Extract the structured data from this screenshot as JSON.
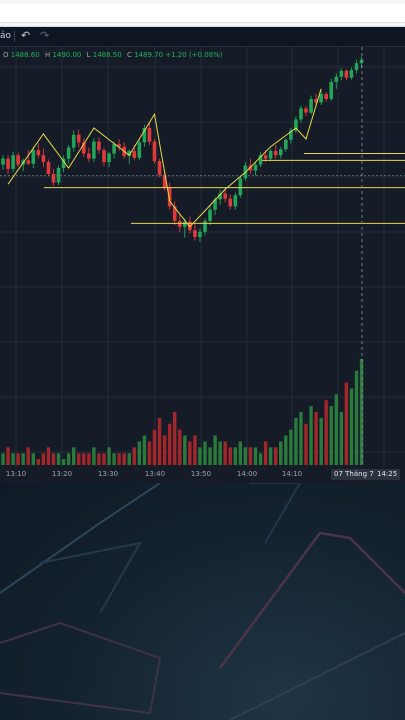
{
  "toolbar": {
    "label": "ảo",
    "undo_icon": "undo-icon",
    "redo_icon": "redo-icon"
  },
  "ohlc": {
    "O": "1488.60",
    "H": "1490.00",
    "L": "1488.50",
    "C": "1489.70",
    "change": "+1.20 (+0.08%)"
  },
  "colors": {
    "up": "#23a559",
    "down": "#e23a3a",
    "vol_up": "#2a7a3c",
    "vol_down": "#a3262b",
    "pattern": "#e8d84a",
    "grid": "#232c39"
  },
  "xaxis": {
    "ticks": [
      "13:10",
      "13:20",
      "13:30",
      "13:40",
      "13:50",
      "14:00",
      "14:10"
    ],
    "crosshair_date": "07 Tháng 7 '25",
    "crosshair_time": "14:25"
  },
  "chart_data": {
    "type": "candlestick",
    "ylim": [
      1465,
      1492
    ],
    "candles": [
      [
        1478.9,
        1480.0,
        1478.3,
        1479.6
      ],
      [
        1479.6,
        1480.0,
        1477.8,
        1478.4
      ],
      [
        1478.4,
        1480.4,
        1478.0,
        1480.0
      ],
      [
        1480.0,
        1480.3,
        1478.6,
        1478.9
      ],
      [
        1478.9,
        1479.6,
        1478.1,
        1479.4
      ],
      [
        1479.4,
        1480.6,
        1478.8,
        1479.0
      ],
      [
        1479.0,
        1481.0,
        1478.5,
        1480.6
      ],
      [
        1480.6,
        1481.4,
        1479.6,
        1480.0
      ],
      [
        1480.0,
        1480.8,
        1478.6,
        1479.2
      ],
      [
        1479.2,
        1479.5,
        1477.6,
        1477.8
      ],
      [
        1477.8,
        1478.4,
        1476.4,
        1476.8
      ],
      [
        1476.8,
        1478.8,
        1476.5,
        1478.5
      ],
      [
        1478.5,
        1480.0,
        1478.0,
        1479.6
      ],
      [
        1479.6,
        1481.2,
        1479.0,
        1480.9
      ],
      [
        1480.9,
        1482.9,
        1480.4,
        1482.4
      ],
      [
        1482.4,
        1483.0,
        1480.9,
        1481.5
      ],
      [
        1481.5,
        1482.0,
        1479.8,
        1480.2
      ],
      [
        1480.2,
        1480.9,
        1479.2,
        1479.6
      ],
      [
        1479.6,
        1482.0,
        1479.2,
        1481.6
      ],
      [
        1481.6,
        1482.1,
        1480.2,
        1480.6
      ],
      [
        1480.6,
        1480.9,
        1478.7,
        1479.2
      ],
      [
        1479.2,
        1480.4,
        1478.6,
        1480.2
      ],
      [
        1480.2,
        1481.6,
        1479.6,
        1481.3
      ],
      [
        1481.3,
        1481.9,
        1480.5,
        1481.0
      ],
      [
        1481.0,
        1481.5,
        1479.6,
        1479.9
      ],
      [
        1479.9,
        1480.7,
        1479.0,
        1480.5
      ],
      [
        1480.5,
        1481.2,
        1479.4,
        1479.7
      ],
      [
        1479.7,
        1481.8,
        1479.4,
        1481.5
      ],
      [
        1481.5,
        1483.6,
        1481.0,
        1483.2
      ],
      [
        1483.2,
        1483.8,
        1481.2,
        1481.6
      ],
      [
        1481.6,
        1481.9,
        1479.0,
        1479.3
      ],
      [
        1479.3,
        1479.6,
        1477.4,
        1477.7
      ],
      [
        1477.7,
        1478.2,
        1475.8,
        1476.2
      ],
      [
        1476.2,
        1476.8,
        1473.6,
        1474.0
      ],
      [
        1474.0,
        1474.6,
        1471.8,
        1472.3
      ],
      [
        1472.3,
        1473.0,
        1471.0,
        1471.6
      ],
      [
        1471.6,
        1472.6,
        1470.3,
        1472.2
      ],
      [
        1472.2,
        1472.8,
        1470.8,
        1471.2
      ],
      [
        1471.2,
        1472.0,
        1470.0,
        1470.4
      ],
      [
        1470.4,
        1471.4,
        1469.8,
        1471.0
      ],
      [
        1471.0,
        1472.6,
        1470.6,
        1472.3
      ],
      [
        1472.3,
        1474.0,
        1471.8,
        1473.6
      ],
      [
        1473.6,
        1475.1,
        1473.0,
        1474.8
      ],
      [
        1474.8,
        1476.0,
        1474.2,
        1475.5
      ],
      [
        1475.5,
        1476.1,
        1474.5,
        1474.9
      ],
      [
        1474.9,
        1475.4,
        1473.6,
        1474.0
      ],
      [
        1474.0,
        1475.6,
        1473.6,
        1475.3
      ],
      [
        1475.3,
        1477.6,
        1475.0,
        1477.3
      ],
      [
        1477.3,
        1479.2,
        1477.0,
        1478.8
      ],
      [
        1478.8,
        1479.6,
        1477.8,
        1478.2
      ],
      [
        1478.2,
        1479.2,
        1477.6,
        1478.9
      ],
      [
        1478.9,
        1480.4,
        1478.6,
        1480.0
      ],
      [
        1480.0,
        1480.6,
        1479.2,
        1479.6
      ],
      [
        1479.6,
        1480.8,
        1479.3,
        1480.5
      ],
      [
        1480.5,
        1481.2,
        1479.6,
        1480.0
      ],
      [
        1480.0,
        1481.0,
        1479.6,
        1480.7
      ],
      [
        1480.7,
        1482.0,
        1480.4,
        1481.8
      ],
      [
        1481.8,
        1483.2,
        1481.4,
        1482.9
      ],
      [
        1482.9,
        1484.6,
        1482.6,
        1484.2
      ],
      [
        1484.2,
        1485.8,
        1483.8,
        1485.5
      ],
      [
        1485.5,
        1485.8,
        1484.6,
        1485.0
      ],
      [
        1485.0,
        1487.0,
        1484.8,
        1486.6
      ],
      [
        1486.6,
        1487.2,
        1485.8,
        1486.2
      ],
      [
        1486.2,
        1487.6,
        1485.9,
        1487.2
      ],
      [
        1487.2,
        1487.4,
        1486.3,
        1486.6
      ],
      [
        1486.6,
        1489.0,
        1486.4,
        1488.6
      ],
      [
        1488.6,
        1489.6,
        1487.8,
        1489.2
      ],
      [
        1489.2,
        1490.2,
        1488.8,
        1489.9
      ],
      [
        1489.9,
        1490.1,
        1488.8,
        1489.1
      ],
      [
        1489.1,
        1490.3,
        1488.9,
        1490.0
      ],
      [
        1490.0,
        1491.2,
        1489.6,
        1490.8
      ],
      [
        1490.8,
        1491.6,
        1490.2,
        1491.2
      ]
    ],
    "volume": [
      2,
      3,
      2,
      2,
      2,
      3,
      2,
      1,
      2,
      3,
      2,
      2,
      1,
      2,
      3,
      2,
      2,
      2,
      3,
      2,
      2,
      3,
      2,
      2,
      2,
      2,
      3,
      4,
      5,
      4,
      6,
      8,
      5,
      7,
      9,
      6,
      5,
      4,
      5,
      3,
      4,
      3,
      5,
      4,
      4,
      3,
      3,
      4,
      3,
      3,
      3,
      2,
      4,
      3,
      3,
      4,
      5,
      6,
      8,
      9,
      7,
      10,
      9,
      8,
      11,
      10,
      12,
      9,
      14,
      13,
      16,
      18
    ],
    "price_levels": [
      1476.2,
      1479.4,
      1480.2,
      1472.0
    ],
    "zigzag": [
      [
        1,
        1476.6
      ],
      [
        8,
        1482.5
      ],
      [
        13,
        1478.5
      ],
      [
        18,
        1483.2
      ],
      [
        25,
        1480.0
      ],
      [
        30,
        1484.8
      ],
      [
        33,
        1474.6
      ],
      [
        37,
        1471.6
      ],
      [
        44,
        1476.0
      ],
      [
        48,
        1478.0
      ],
      [
        53,
        1481.0
      ],
      [
        58,
        1483.2
      ],
      [
        60,
        1481.9
      ],
      [
        63,
        1487.8
      ]
    ]
  }
}
